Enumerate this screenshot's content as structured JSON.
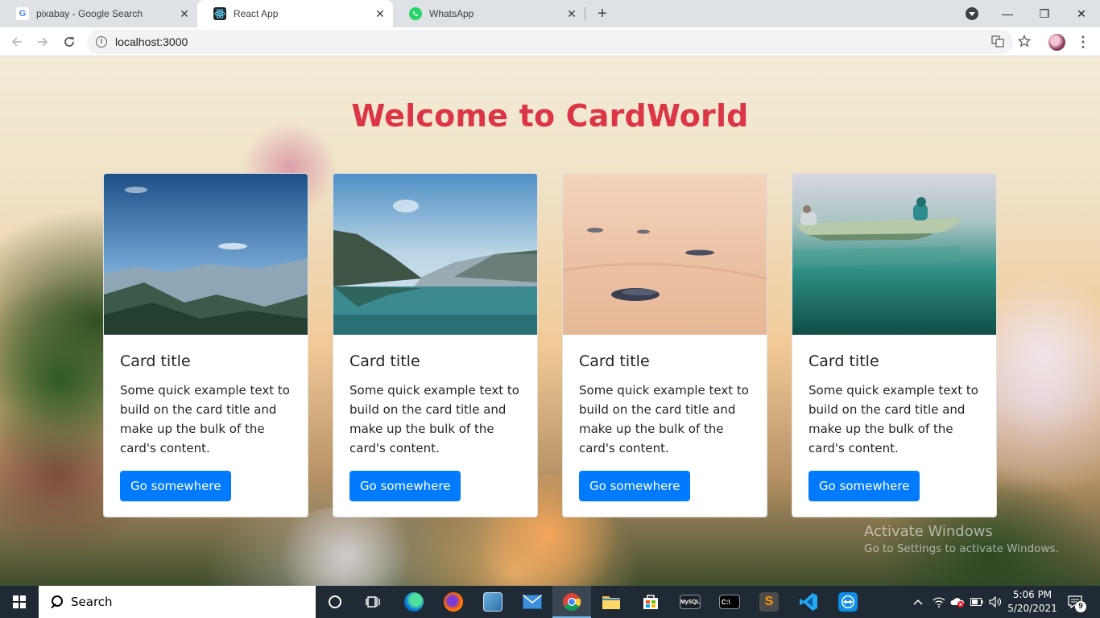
{
  "browser": {
    "tabs": [
      {
        "title": "pixabay - Google Search",
        "icon": "google-icon",
        "active": false
      },
      {
        "title": "React App",
        "icon": "react-icon",
        "active": true
      },
      {
        "title": "WhatsApp",
        "icon": "whatsapp-icon",
        "active": false
      }
    ],
    "url": "localhost:3000",
    "new_tab_label": "+",
    "close_glyph": "✕",
    "window_controls": {
      "minimize": "—",
      "restore": "❐",
      "close": "✕"
    }
  },
  "page": {
    "heading": "Welcome to CardWorld",
    "heading_color": "#dc3545",
    "button_color": "#007bff",
    "cards": [
      {
        "image": "mountain-valley-sky",
        "title": "Card title",
        "text": "Some quick example text to build on the card title and make up the bulk of the card's content.",
        "button": "Go somewhere"
      },
      {
        "image": "mountain-lake-reflection",
        "title": "Card title",
        "text": "Some quick example text to build on the card title and make up the bulk of the card's content.",
        "button": "Go somewhere"
      },
      {
        "image": "pebbles-on-sand",
        "title": "Card title",
        "text": "Some quick example text to build on the card title and make up the bulk of the card's content.",
        "button": "Go somewhere"
      },
      {
        "image": "canoe-on-lake",
        "title": "Card title",
        "text": "Some quick example text to build on the card title and make up the bulk of the card's content.",
        "button": "Go somewhere"
      }
    ]
  },
  "watermark": {
    "line1": "Activate Windows",
    "line2": "Go to Settings to activate Windows."
  },
  "taskbar": {
    "search_label": "Search",
    "time": "5:06 PM",
    "date": "5/20/2021",
    "notification_count": "9",
    "apps": [
      "cortana-icon",
      "task-view-icon",
      "edge-icon",
      "firefox-icon",
      "control-panel-icon",
      "mail-icon",
      "chrome-icon",
      "file-explorer-icon",
      "store-icon",
      "mysql-icon",
      "terminal-icon",
      "sublime-text-icon",
      "vscode-icon",
      "teamviewer-icon"
    ]
  }
}
